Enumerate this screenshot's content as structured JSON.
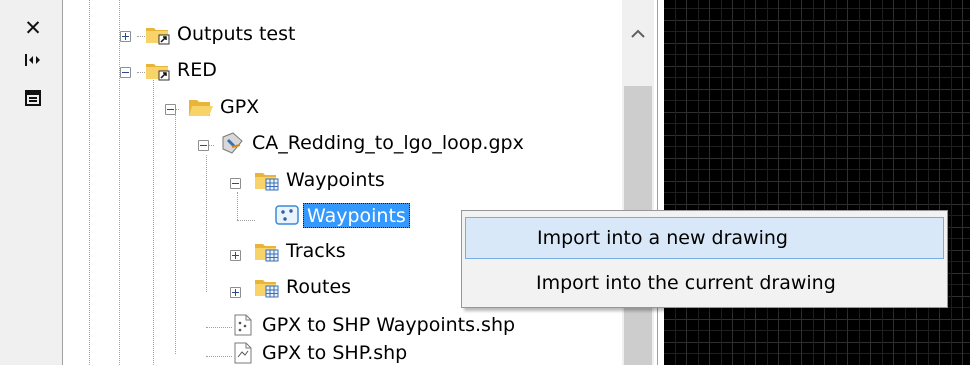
{
  "toolstrip": {
    "buttons": [
      {
        "icon": "close-icon",
        "glyph": "✕"
      },
      {
        "icon": "auto-hide-icon",
        "glyph": "⊩"
      },
      {
        "icon": "properties-icon",
        "glyph": "▣"
      }
    ]
  },
  "tree": {
    "nodes": [
      {
        "label": "Outputs test",
        "icon": "folder-shortcut-icon",
        "expander": "plus"
      },
      {
        "label": "RED",
        "icon": "folder-shortcut-icon",
        "expander": "minus"
      },
      {
        "label": "GPX",
        "icon": "folder-open-icon",
        "expander": "minus"
      },
      {
        "label": "CA_Redding_to_lgo_loop.gpx",
        "icon": "gpx-file-icon",
        "expander": "minus"
      },
      {
        "label": "Waypoints",
        "icon": "feature-folder-icon",
        "expander": "minus"
      },
      {
        "label": "Waypoints",
        "icon": "point-layer-icon",
        "expander": "none",
        "selected": true
      },
      {
        "label": "Tracks",
        "icon": "feature-folder-icon",
        "expander": "plus"
      },
      {
        "label": "Routes",
        "icon": "feature-folder-icon",
        "expander": "plus"
      },
      {
        "label": "GPX to SHP Waypoints.shp",
        "icon": "shapefile-points-icon",
        "expander": "none"
      },
      {
        "label": "GPX to SHP.shp",
        "icon": "shapefile-icon",
        "expander": "none"
      }
    ]
  },
  "context_menu": {
    "items": [
      {
        "label": "Import into a new drawing",
        "highlighted": true
      },
      {
        "label": "Import into the current drawing",
        "highlighted": false
      }
    ]
  },
  "colors": {
    "selection": "#3399ff",
    "menu_highlight": "#d9e8f8",
    "folder": "#f4c54f",
    "canvas": "#000000"
  }
}
